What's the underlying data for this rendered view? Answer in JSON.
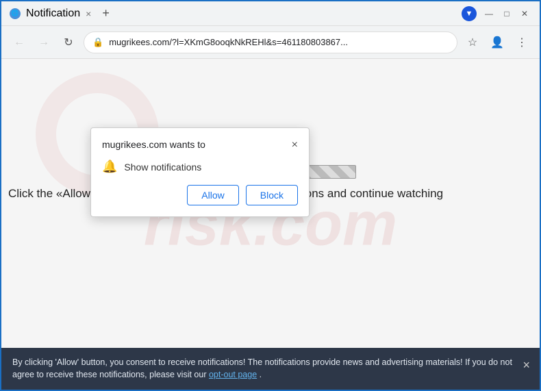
{
  "browser": {
    "tab_title": "Notification",
    "tab_close_symbol": "×",
    "new_tab_symbol": "+",
    "nav_back": "←",
    "nav_forward": "→",
    "nav_refresh": "↻",
    "url": "mugrikees.com/?l=XKmG8ooqkNkREHl&s=461180803867...",
    "url_full": "mugrikees.com/?l=XKmG8ooqkNkREHl&s=461180803867...",
    "star_symbol": "☆",
    "menu_symbol": "⋮",
    "minimize": "—",
    "maximize": "□",
    "close": "✕"
  },
  "popup": {
    "title": "mugrikees.com wants to",
    "close_symbol": "×",
    "bell_symbol": "🔔",
    "description": "Show notifications",
    "allow_label": "Allow",
    "block_label": "Block"
  },
  "page": {
    "watermark_text": "risk.com",
    "page_message": "Click the «Allow» button to subscribe to the push notifications and continue watching"
  },
  "banner": {
    "text_part1": "By clicking 'Allow' button, you consent to receive notifications! The notifications provide news and advertising materials! If you do not agree to receive these notifications, please visit our ",
    "link_text": "opt-out page",
    "text_part2": ".",
    "close_symbol": "×"
  }
}
